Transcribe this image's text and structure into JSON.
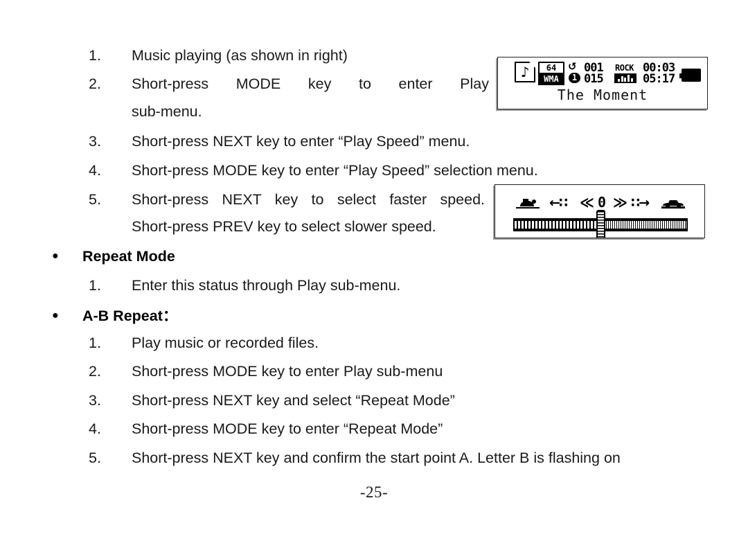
{
  "document": {
    "page_number": "-25-"
  },
  "sections": [
    {
      "type": "numbered_list",
      "items": [
        {
          "num": "1.",
          "text": "Music playing (as shown in right)"
        },
        {
          "num": "2.",
          "text": "Short-press MODE key to enter Play",
          "cont": "sub-menu."
        },
        {
          "num": "3.",
          "text": "Short-press NEXT key to enter “Play Speed” menu."
        },
        {
          "num": "4.",
          "text": "Short-press MODE key to enter “Play Speed” selection menu."
        },
        {
          "num": "5.",
          "text": "Short-press NEXT key to select faster speed.",
          "cont": "Short-press PREV key to select slower speed."
        }
      ]
    },
    {
      "type": "bullet_heading",
      "bullet": "●",
      "title": "Repeat Mode",
      "items": [
        {
          "num": "1.",
          "text": "Enter this status through Play sub-menu."
        }
      ]
    },
    {
      "type": "bullet_heading",
      "bullet": "●",
      "title": "A-B Repeat：",
      "items": [
        {
          "num": "1.",
          "text": "Play music or recorded files."
        },
        {
          "num": "2.",
          "text": "Short-press MODE key to enter Play sub-menu"
        },
        {
          "num": "3.",
          "text": "Short-press NEXT key and select “Repeat Mode”"
        },
        {
          "num": "4.",
          "text": "Short-press MODE key to enter “Repeat Mode”"
        },
        {
          "num": "5.",
          "text": "Short-press NEXT key and confirm the start point A. Letter B is flashing on"
        }
      ]
    }
  ],
  "figures": {
    "now_playing": {
      "caption_name": "now-playing-lcd",
      "file_icon": "music-file-icon",
      "bitrate": "64",
      "format": "WMA",
      "repeat_icon": "loop-icon",
      "repeat_one": "1",
      "track_index": "001",
      "genre": "ROCK",
      "elapsed_time": "00:03",
      "total_tracks": "015",
      "eq_icon": "equalizer-icon",
      "duration": "05:17",
      "battery_icon": "battery-full-icon",
      "title": "The Moment"
    },
    "play_speed": {
      "caption_name": "play-speed-lcd",
      "slow_icon": "turtle-slow-icon",
      "arrow_left": "←∷",
      "chevron_left": "≪",
      "value": "0",
      "chevron_right": "≫",
      "arrow_right": "∷→",
      "fast_icon": "car-fast-icon",
      "slider_handle": "speed-slider-handle"
    }
  }
}
